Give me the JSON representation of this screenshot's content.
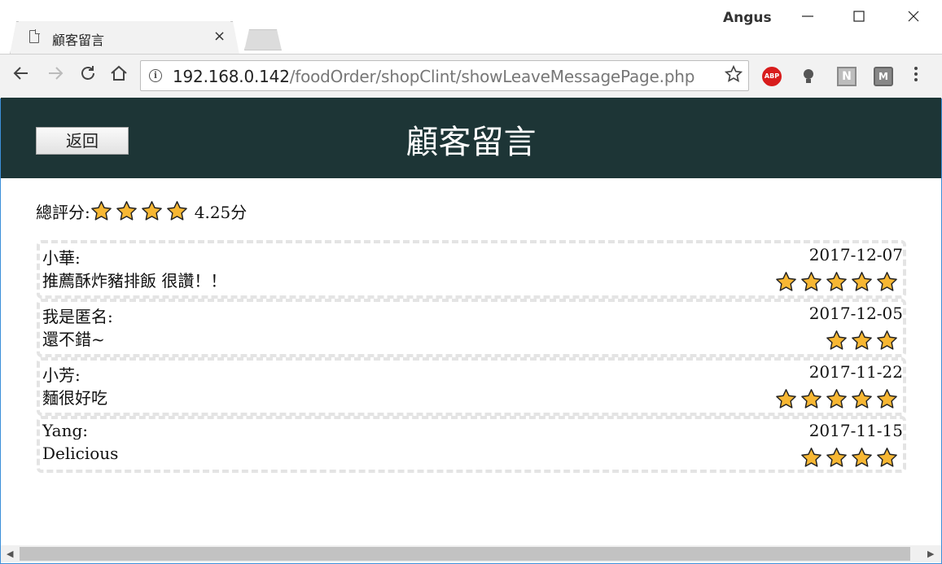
{
  "browser": {
    "tab_title": "顧客留言",
    "tab_close": "×",
    "profile_name": "Angus",
    "url_host": "192.168.0.142",
    "url_path": "/foodOrder/shopClint/showLeaveMessagePage.php",
    "ext_abp": "ABP",
    "ext_n": "N",
    "ext_m": "M",
    "icons": {
      "back": "arrow-left-icon",
      "forward": "arrow-right-icon",
      "reload": "reload-icon",
      "home": "home-icon",
      "info": "info-icon",
      "bookmark": "star-outline-icon",
      "menu": "kebab-menu-icon"
    }
  },
  "header": {
    "back_label": "返回",
    "title": "顧客留言",
    "background": "#1d3536"
  },
  "summary": {
    "label": "總評分:",
    "stars": 4,
    "score": "4.25分"
  },
  "reviews": [
    {
      "user": "小華:",
      "message": "推薦酥炸豬排飯 很讚！！",
      "date": "2017-12-07",
      "stars": 5
    },
    {
      "user": "我是匿名:",
      "message": "還不錯~",
      "date": "2017-12-05",
      "stars": 3
    },
    {
      "user": "小芳:",
      "message": "麵很好吃",
      "date": "2017-11-22",
      "stars": 5
    },
    {
      "user": "Yang:",
      "message": "Delicious",
      "date": "2017-11-15",
      "stars": 4
    }
  ],
  "colors": {
    "star_fill": "#f7b733",
    "star_stroke": "#222222"
  }
}
